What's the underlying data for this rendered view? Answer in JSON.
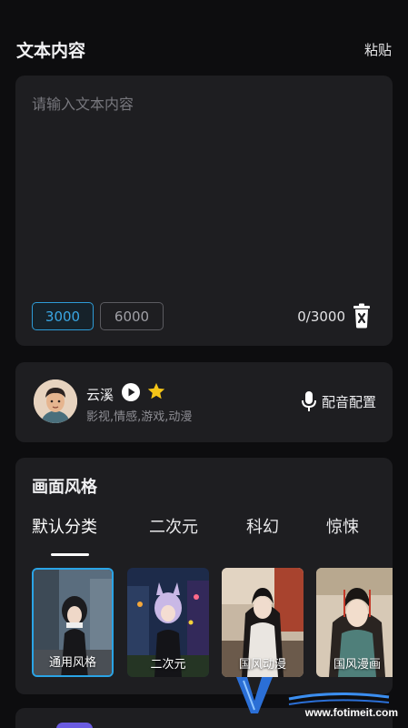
{
  "header": {
    "title": "文本内容",
    "paste_label": "粘贴"
  },
  "text_input": {
    "placeholder": "请输入文本内容",
    "limits": [
      "3000",
      "6000"
    ],
    "selected_limit": "3000",
    "counter": "0/3000"
  },
  "voice": {
    "name": "云溪",
    "tags": "影视,情感,游戏,动漫",
    "dub_config_label": "配音配置"
  },
  "style": {
    "title": "画面风格",
    "tabs": [
      "默认分类",
      "二次元",
      "科幻",
      "惊悚"
    ],
    "active_tab": "默认分类",
    "items": [
      {
        "label": "通用风格",
        "selected": true
      },
      {
        "label": "二次元",
        "selected": false
      },
      {
        "label": "国风动漫",
        "selected": false
      },
      {
        "label": "国风漫画",
        "selected": false
      }
    ]
  },
  "watermark": {
    "url": "www.fotimeit.com"
  },
  "colors": {
    "accent": "#2e9bd6",
    "card": "#1e1e21",
    "background": "#0d0d0f",
    "star": "#f5c518"
  }
}
